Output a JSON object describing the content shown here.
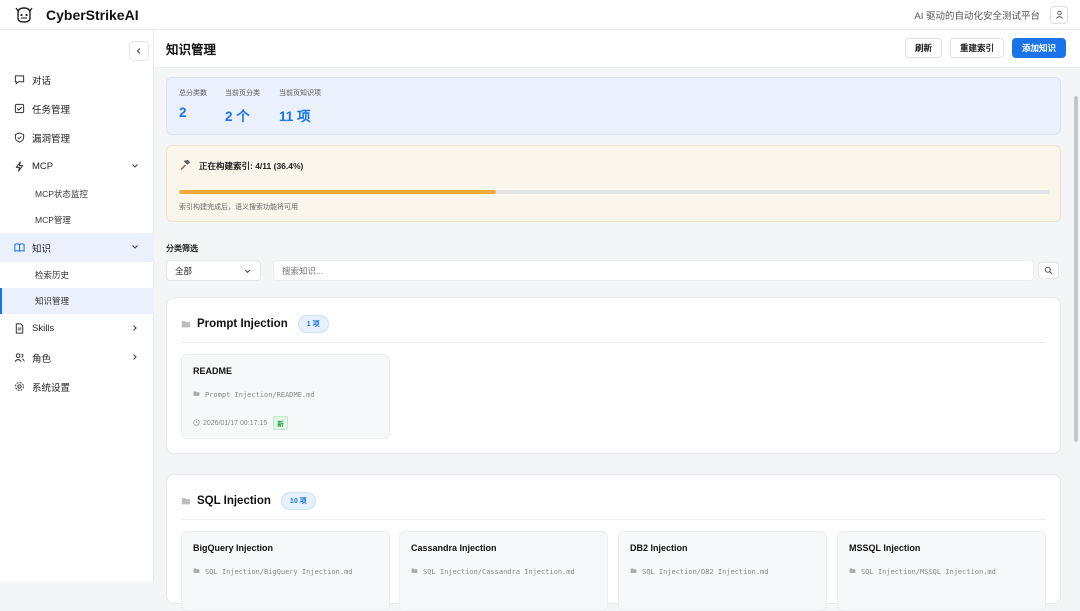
{
  "app": {
    "name": "CyberStrikeAI",
    "tagline": "AI 驱动的自动化安全测试平台"
  },
  "sidebar": {
    "items": [
      {
        "label": "对话",
        "icon": "chat-icon"
      },
      {
        "label": "任务管理",
        "icon": "checklist-icon"
      },
      {
        "label": "漏洞管理",
        "icon": "shield-icon"
      },
      {
        "label": "MCP",
        "icon": "bolt-icon",
        "expanded": true,
        "children": [
          {
            "label": "MCP状态监控"
          },
          {
            "label": "MCP管理"
          }
        ]
      },
      {
        "label": "知识",
        "icon": "book-icon",
        "expanded": true,
        "active": true,
        "children": [
          {
            "label": "检索历史"
          },
          {
            "label": "知识管理",
            "active": true
          }
        ]
      },
      {
        "label": "Skills",
        "icon": "file-icon"
      },
      {
        "label": "角色",
        "icon": "users-icon"
      },
      {
        "label": "系统设置",
        "icon": "gear-icon"
      }
    ]
  },
  "header": {
    "title": "知识管理",
    "buttons": {
      "refresh": "刷新",
      "rebuild": "重建索引",
      "add": "添加知识"
    }
  },
  "stats": [
    {
      "label": "总分类数",
      "value": "2"
    },
    {
      "label": "当前页分类",
      "value": "2 个"
    },
    {
      "label": "当前页知识项",
      "value": "11 项"
    }
  ],
  "build": {
    "title": "正在构建索引: 4/11 (36.4%)",
    "progress": 0.364,
    "hint": "索引构建完成后，语义搜索功能将可用",
    "color": "#f2a93b"
  },
  "filter": {
    "label": "分类筛选",
    "category_value": "全部",
    "search_placeholder": "搜索知识..."
  },
  "sections": [
    {
      "title": "Prompt Injection",
      "count": "1 项",
      "cards": [
        {
          "title": "README",
          "path": "Prompt Injection/README.md",
          "date": "2026/01/17 00:17:15",
          "tag": "新"
        }
      ]
    },
    {
      "title": "SQL Injection",
      "count": "10 项",
      "cards": [
        {
          "title": "BigQuery Injection",
          "path": "SQL Injection/BigQuery Injection.md"
        },
        {
          "title": "Cassandra Injection",
          "path": "SQL Injection/Cassandra Injection.md"
        },
        {
          "title": "DB2 Injection",
          "path": "SQL Injection/DB2 Injection.md"
        },
        {
          "title": "MSSQL Injection",
          "path": "SQL Injection/MSSQL Injection.md"
        }
      ]
    }
  ],
  "colors": {
    "accent": "#1a73e8",
    "progress": "#f2a93b",
    "new_tag": "#2e9b4c"
  }
}
